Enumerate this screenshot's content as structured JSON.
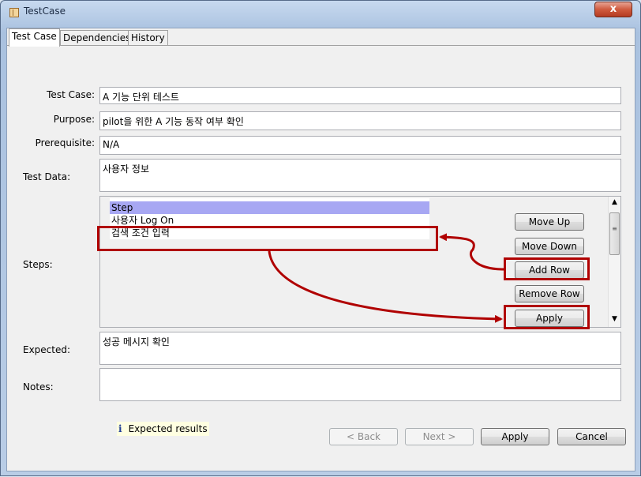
{
  "window": {
    "title": "TestCase",
    "close_glyph": "x",
    "icon": "document-icon"
  },
  "tabs": [
    {
      "label": "Test Case",
      "active": true
    },
    {
      "label": "Dependencies",
      "active": false
    },
    {
      "label": "History",
      "active": false
    }
  ],
  "form": {
    "test_case": {
      "label": "Test Case:",
      "value": "A 기능 단위 테스트"
    },
    "purpose": {
      "label": "Purpose:",
      "value": "pilot을 위한 A 기능 동작 여부 확인"
    },
    "prerequisite": {
      "label": "Prerequisite:",
      "value": "N/A"
    },
    "test_data": {
      "label": "Test Data:",
      "value": "사용자 정보"
    },
    "steps": {
      "label": "Steps:",
      "rows": [
        "Step",
        "사용자 Log On",
        "검색 조건 입력"
      ],
      "selected_index": 0
    },
    "expected": {
      "label": "Expected:",
      "value": "성공 메시지 확인"
    },
    "notes": {
      "label": "Notes:",
      "value": ""
    }
  },
  "step_buttons": {
    "move_up": "Move Up",
    "move_down": "Move Down",
    "add_row": "Add Row",
    "remove_row": "Remove Row",
    "apply": "Apply"
  },
  "info": {
    "icon": "i",
    "text": "Expected results"
  },
  "footer_buttons": {
    "back": "< Back",
    "next": "Next >",
    "apply": "Apply",
    "cancel": "Cancel"
  },
  "colors": {
    "highlight": "#b00000",
    "selection": "#a7a7f3",
    "info_bg": "#ffffe1"
  }
}
